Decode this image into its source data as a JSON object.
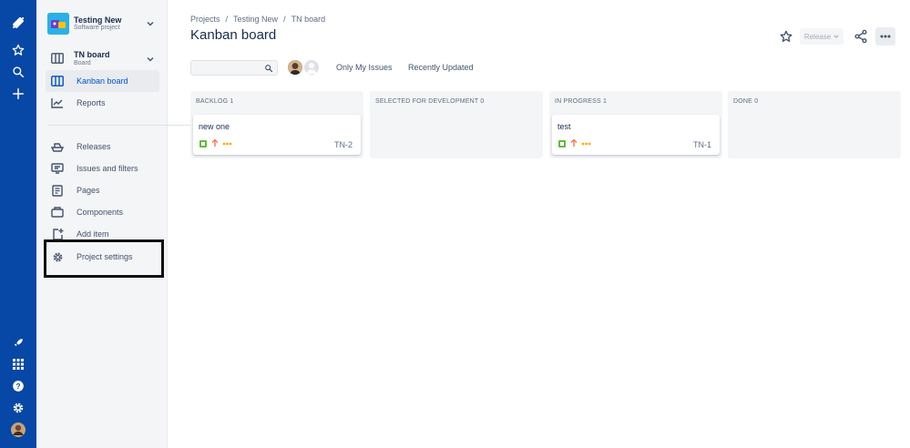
{
  "colors": {
    "global_nav": "#0747a6",
    "sidebar_bg": "#f4f5f7",
    "active_link": "#0052cc",
    "story_green": "#63ba3c",
    "priority_orange": "#ff7452"
  },
  "global_nav": {
    "icons": [
      "jira-logo-icon",
      "star-icon",
      "search-icon",
      "plus-icon",
      "rocket-icon",
      "app-switcher-icon",
      "help-icon",
      "settings-icon",
      "user-avatar"
    ]
  },
  "sidebar": {
    "project_name": "Testing New",
    "project_type": "Software project",
    "board_name": "TN board",
    "board_type": "Board",
    "items": [
      {
        "label": "Kanban board",
        "icon": "kanban-icon",
        "active": true
      },
      {
        "label": "Reports",
        "icon": "reports-icon"
      },
      {
        "label": "Releases",
        "icon": "ship-icon"
      },
      {
        "label": "Issues and filters",
        "icon": "issues-icon"
      },
      {
        "label": "Pages",
        "icon": "pages-icon"
      },
      {
        "label": "Components",
        "icon": "components-icon"
      },
      {
        "label": "Add item",
        "icon": "add-item-icon"
      },
      {
        "label": "Project settings",
        "icon": "gear-icon"
      }
    ]
  },
  "breadcrumb": [
    "Projects",
    "Testing New",
    "TN board"
  ],
  "page_title": "Kanban board",
  "header_actions": {
    "release_label": "Release"
  },
  "filters": {
    "search_value": "",
    "only_my_issues": "Only My Issues",
    "recently_updated": "Recently Updated"
  },
  "columns": [
    {
      "name": "BACKLOG",
      "count": "1",
      "cards": [
        {
          "title": "new one",
          "key": "TN-2"
        }
      ]
    },
    {
      "name": "SELECTED FOR DEVELOPMENT",
      "count": "0",
      "cards": []
    },
    {
      "name": "IN PROGRESS",
      "count": "1",
      "cards": [
        {
          "title": "test",
          "key": "TN-1"
        }
      ]
    },
    {
      "name": "DONE",
      "count": "0",
      "cards": []
    }
  ]
}
